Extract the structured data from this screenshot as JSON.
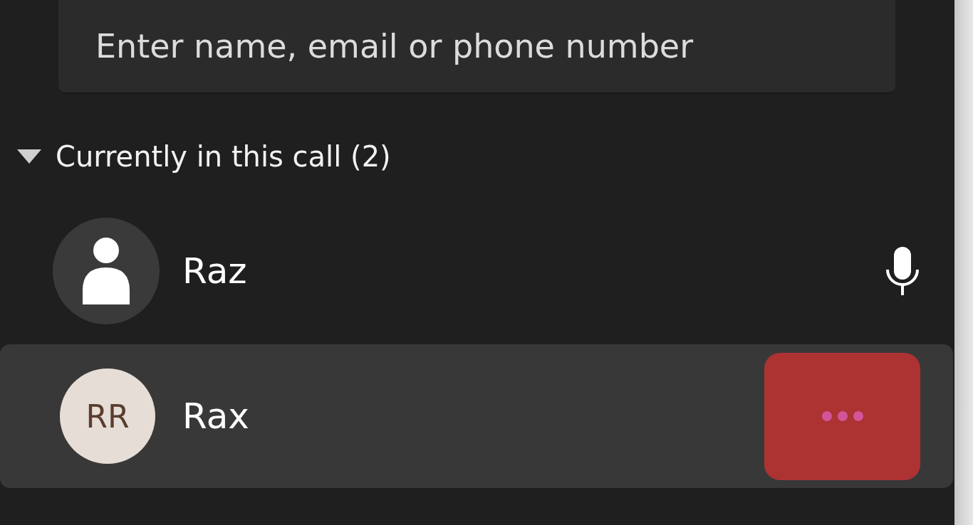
{
  "search": {
    "placeholder": "Enter name, email or phone number"
  },
  "section": {
    "label": "Currently in this call (2)",
    "expanded": true
  },
  "participants": [
    {
      "name": "Raz",
      "avatar": {
        "kind": "silhouette"
      },
      "selected": false,
      "kind": "mic"
    },
    {
      "name": "Rax",
      "avatar": {
        "kind": "initials",
        "initials": "RR"
      },
      "selected": true,
      "kind": "more"
    }
  ]
}
